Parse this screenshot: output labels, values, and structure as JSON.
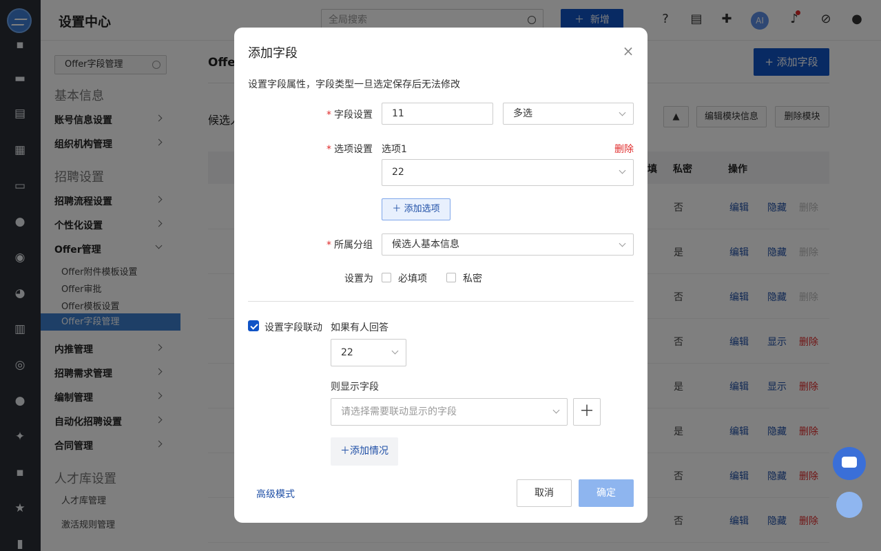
{
  "app": {
    "title": "设置中心"
  },
  "header": {
    "search_placeholder": "全局搜索",
    "new_label": "新增",
    "ai_label": "AI"
  },
  "rail": {
    "icons": [
      "dashboard-icon",
      "briefcase-icon",
      "document-icon",
      "calendar-icon",
      "id-card-icon",
      "wechat-icon",
      "thumb-icon",
      "pie-chart-icon",
      "bar-chart-icon",
      "user-circle-icon",
      "users-icon",
      "user-star-icon",
      "message-icon",
      "star-icon",
      "clipboard-icon"
    ]
  },
  "nav": {
    "search_value": "Offer字段管理",
    "group_basic": "基本信息",
    "account_settings": "账号信息设置",
    "org_management": "组织机构管理",
    "group_recruit": "招聘设置",
    "recruit_flow": "招聘流程设置",
    "personalization": "个性化设置",
    "offer_management": "Offer管理",
    "offer_attach_tpl": "Offer附件模板设置",
    "offer_approval": "Offer审批",
    "offer_tpl": "Offer模板设置",
    "offer_field": "Offer字段管理",
    "referral": "内推管理",
    "req_management": "招聘需求管理",
    "headcount": "编制管理",
    "auto_recruit": "自动化招聘设置",
    "contract": "合同管理",
    "group_talent": "人才库设置",
    "talent_pool": "人才库管理",
    "activation_rules": "激活规则管理"
  },
  "main": {
    "page_title": "Offer",
    "add_field_label": "+ 添加字段",
    "section_title": "候选人",
    "edit_module": "编辑模块信息",
    "delete_module": "删除模块",
    "col_required_fragment": "填",
    "col_private": "私密",
    "col_actions": "操作",
    "rows": [
      {
        "private": "否",
        "edit": "编辑",
        "toggle": "隐藏",
        "delete": "删除",
        "delete_disabled": true
      },
      {
        "private": "是",
        "edit": "编辑",
        "toggle": "隐藏",
        "delete": "删除",
        "delete_disabled": true
      },
      {
        "private": "否",
        "edit": "编辑",
        "toggle": "隐藏",
        "delete": "删除",
        "delete_disabled": true
      },
      {
        "private": "否",
        "edit": "编辑",
        "toggle": "显示",
        "delete": "删除",
        "delete_disabled": false
      },
      {
        "private": "是",
        "edit": "编辑",
        "toggle": "显示",
        "delete": "删除",
        "delete_disabled": false
      },
      {
        "private": "是",
        "edit": "编辑",
        "toggle": "隐藏",
        "delete": "删除",
        "delete_disabled": false
      },
      {
        "private": "否",
        "edit": "编辑",
        "toggle": "隐藏",
        "delete": "删除",
        "delete_disabled": false
      },
      {
        "private": "否",
        "edit": "编辑",
        "toggle": "隐藏",
        "delete": "删除",
        "delete_disabled": false
      }
    ]
  },
  "modal": {
    "title": "添加字段",
    "description": "设置字段属性，字段类型一旦选定保存后无法修改",
    "field_label": "字段设置",
    "field_name_value": "11",
    "field_type_value": "多选",
    "option_label": "选项设置",
    "option1_label": "选项1",
    "option_delete": "删除",
    "option1_value": "22",
    "add_option": "添加选项",
    "group_label": "所属分组",
    "group_value": "候选人基本信息",
    "set_as_label": "设置为",
    "required_label": "必填项",
    "private_label": "私密",
    "linkage_label": "设置字段联动",
    "if_answer_label": "如果有人回答",
    "answer_value": "22",
    "show_field_label": "则显示字段",
    "show_field_placeholder": "请选择需要联动显示的字段",
    "add_case": "添加情况",
    "advanced_mode": "高级模式",
    "cancel": "取消",
    "confirm": "确定"
  },
  "colors": {
    "primary": "#1154c6",
    "danger": "#e02b2b",
    "link": "#1f4fa6",
    "nav_active": "#3d7fce",
    "disabled_confirm": "#8eb5ef"
  }
}
